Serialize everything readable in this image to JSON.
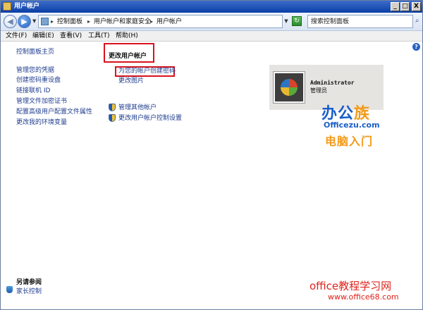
{
  "window": {
    "title": "用户帐户"
  },
  "title_buttons": {
    "minimize": "_",
    "maximize": "□",
    "close": "X"
  },
  "nav": {
    "back_icon": "arrow-left-icon",
    "forward_icon": "arrow-right-icon",
    "breadcrumbs": [
      "控制面板",
      "用户帐户和家庭安全",
      "用户帐户"
    ],
    "search_placeholder": "搜索控制面板"
  },
  "menu": [
    "文件(F)",
    "编辑(E)",
    "查看(V)",
    "工具(T)",
    "帮助(H)"
  ],
  "sidebar": {
    "items": [
      "控制面板主页",
      "管理您的凭据",
      "创建密码重设盘",
      "链接联机 ID",
      "管理文件加密证书",
      "配置高级用户配置文件属性",
      "更改我的环境变量"
    ],
    "see_also_title": "另请参阅",
    "see_also_item": "家长控制"
  },
  "main": {
    "title": "更改用户帐户",
    "tasks": [
      "为您的帐户创建密码",
      "更改图片"
    ],
    "shield_tasks": [
      "管理其他帐户",
      "更改用户帐户控制设置"
    ]
  },
  "account": {
    "name": "Administrator",
    "role": "管理员"
  },
  "branding": {
    "name_a": "办公",
    "name_b": "族",
    "site": "Officezu.com",
    "tagline": "电脑入门"
  },
  "watermark": {
    "line1": "office教程学习网",
    "line2": "www.office68.com"
  },
  "colors": {
    "titlebar": "#0a3fa8",
    "link": "#1f3d8f",
    "highlight": "#d8131f",
    "brand_blue": "#1a5ec7",
    "brand_orange": "#f39a18",
    "watermark": "#e0231c"
  }
}
